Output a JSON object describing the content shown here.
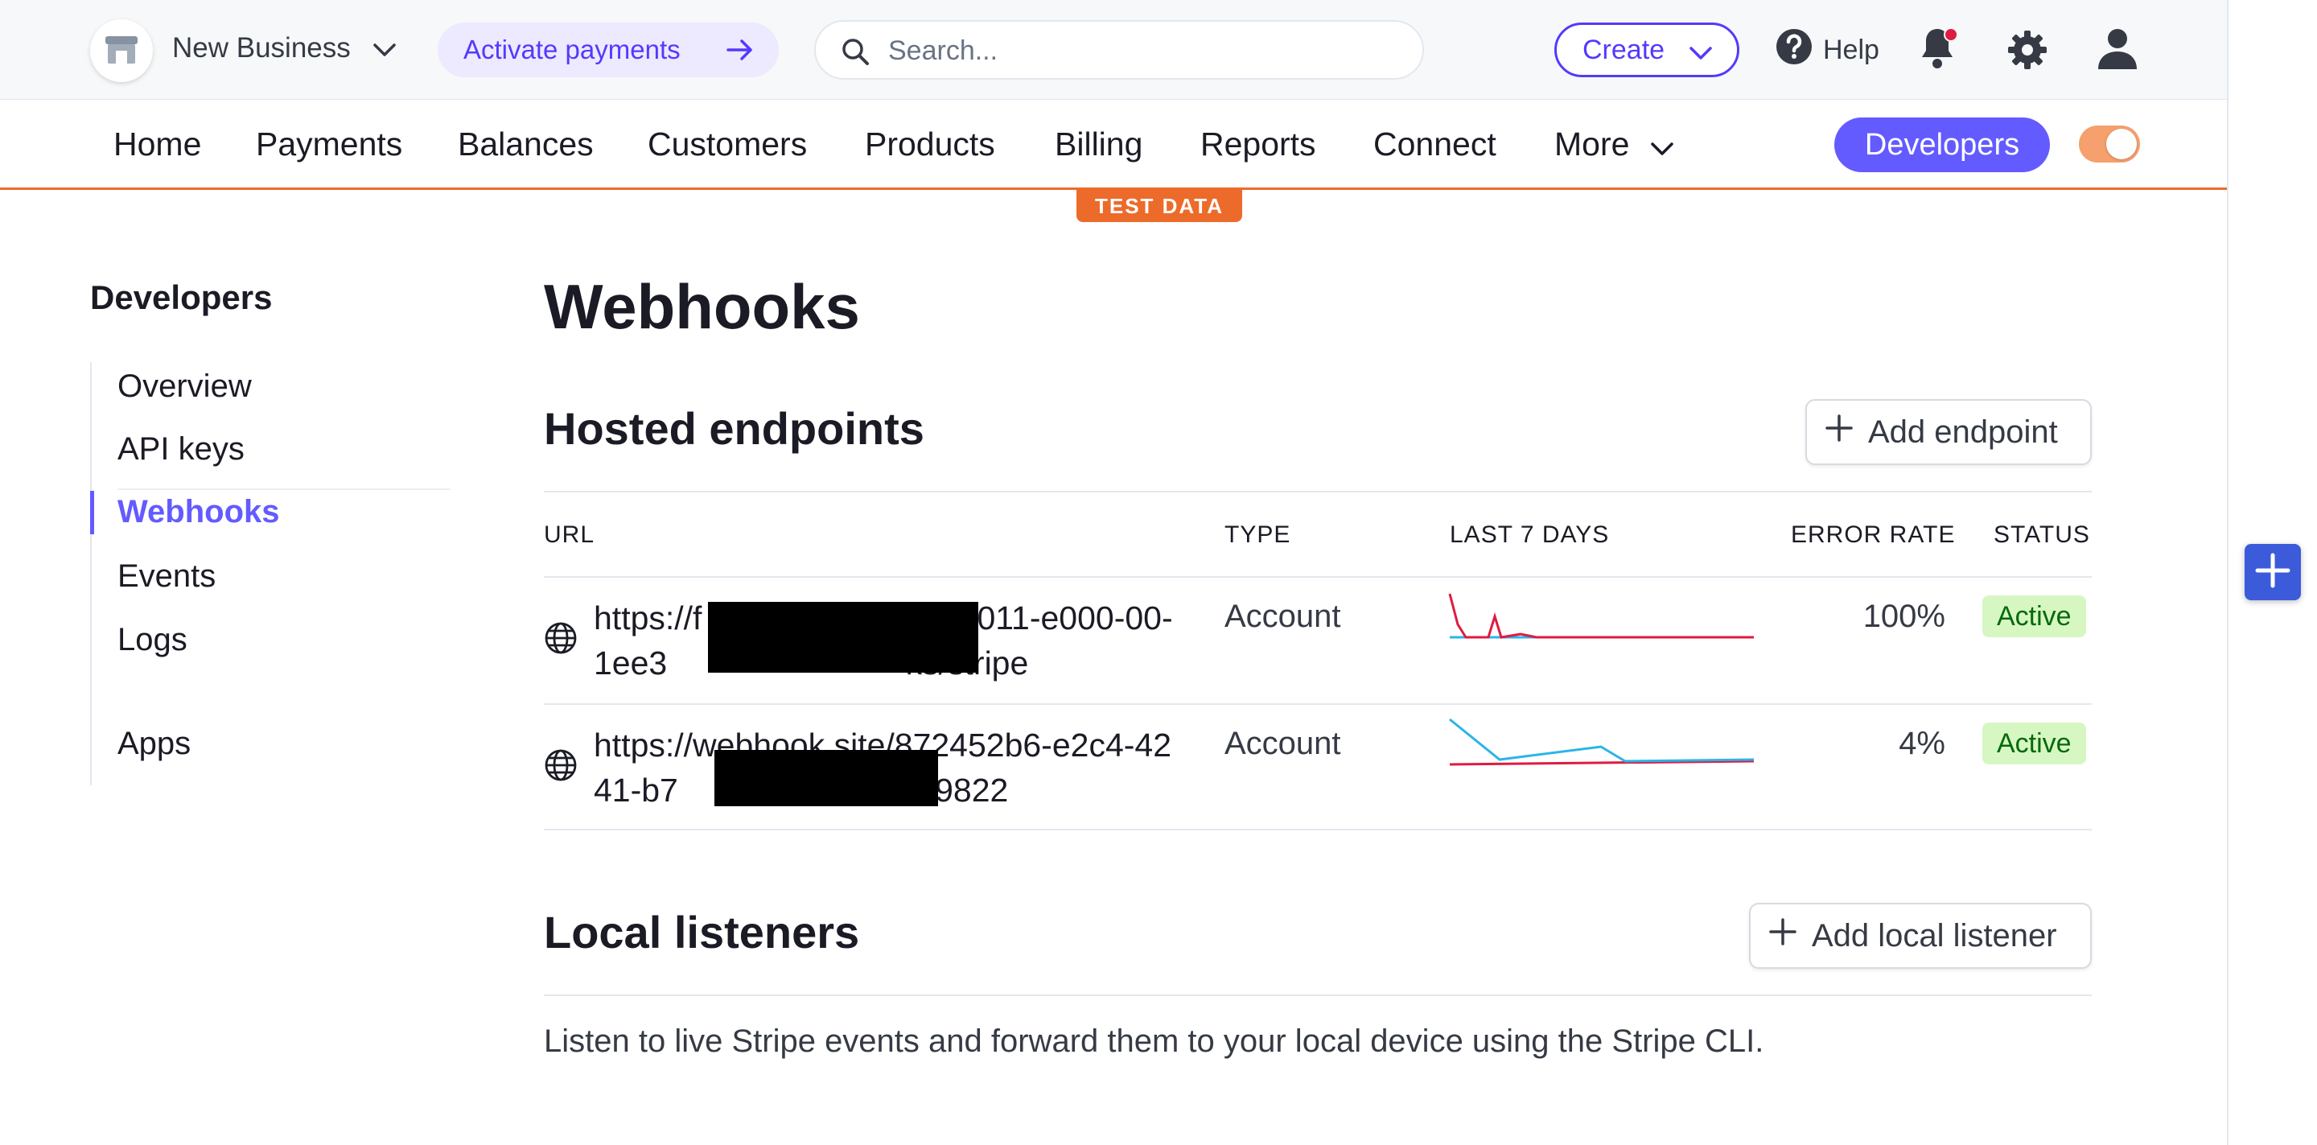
{
  "topbar": {
    "business_name": "New Business",
    "activate_label": "Activate payments",
    "search_placeholder": "Search...",
    "create_label": "Create",
    "help_label": "Help",
    "icons": [
      "store-icon",
      "chevron-down-icon",
      "arrow-right-icon",
      "search-icon",
      "help-circle-icon",
      "bell-icon",
      "gear-icon",
      "user-icon"
    ]
  },
  "nav": {
    "items": [
      "Home",
      "Payments",
      "Balances",
      "Customers",
      "Products",
      "Billing",
      "Reports",
      "Connect",
      "More"
    ],
    "developers_label": "Developers",
    "test_mode_on": true,
    "test_badge": "TEST DATA",
    "accent_color": "#ed6b2a"
  },
  "sidebar": {
    "title": "Developers",
    "items": [
      "Overview",
      "API keys",
      "Webhooks",
      "Events",
      "Logs",
      "Apps"
    ],
    "active": "Webhooks"
  },
  "main": {
    "title": "Webhooks",
    "hosted": {
      "title": "Hosted endpoints",
      "add_label": "Add endpoint",
      "columns": [
        "URL",
        "TYPE",
        "LAST 7 DAYS",
        "ERROR RATE",
        "STATUS"
      ],
      "rows": [
        {
          "url": "https://f              4011-e000-00-1ee3             ks/stripe",
          "type": "Account",
          "error_rate": "100%",
          "status": "Active"
        },
        {
          "url": "https://webhook.site/872452b6-e2c4-4241-b7              9822",
          "type": "Account",
          "error_rate": "4%",
          "status": "Active"
        }
      ]
    },
    "local": {
      "title": "Local listeners",
      "add_label": "Add local listener",
      "description": "Listen to live Stripe events and forward them to your local device using the Stripe CLI."
    }
  },
  "colors": {
    "brand": "#635bff",
    "status_active_bg": "#d7f7c2",
    "status_active_text": "#05690d"
  }
}
